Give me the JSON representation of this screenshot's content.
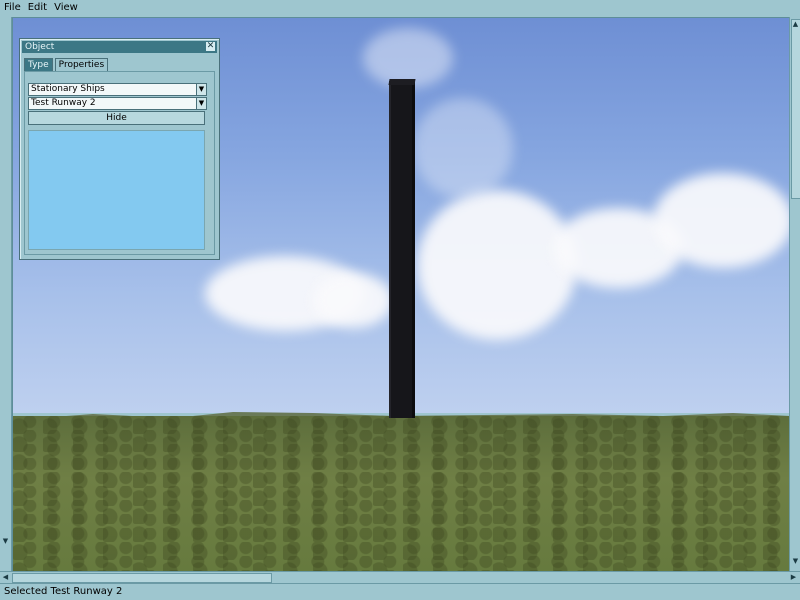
{
  "menu": {
    "items": [
      "File",
      "Edit",
      "View"
    ]
  },
  "panel": {
    "title": "Object",
    "close_icon": "✕",
    "tabs": [
      "Type",
      "Properties"
    ],
    "active_tab": "Type",
    "category_select": "Stationary Ships",
    "object_select": "Test Runway 2",
    "hide_label": "Hide",
    "preview_color": "#83c9f0"
  },
  "status": {
    "text": "Selected Test Runway 2"
  },
  "colors": {
    "ui_background": "#9ec6cf",
    "title_bar": "#3c7785"
  }
}
